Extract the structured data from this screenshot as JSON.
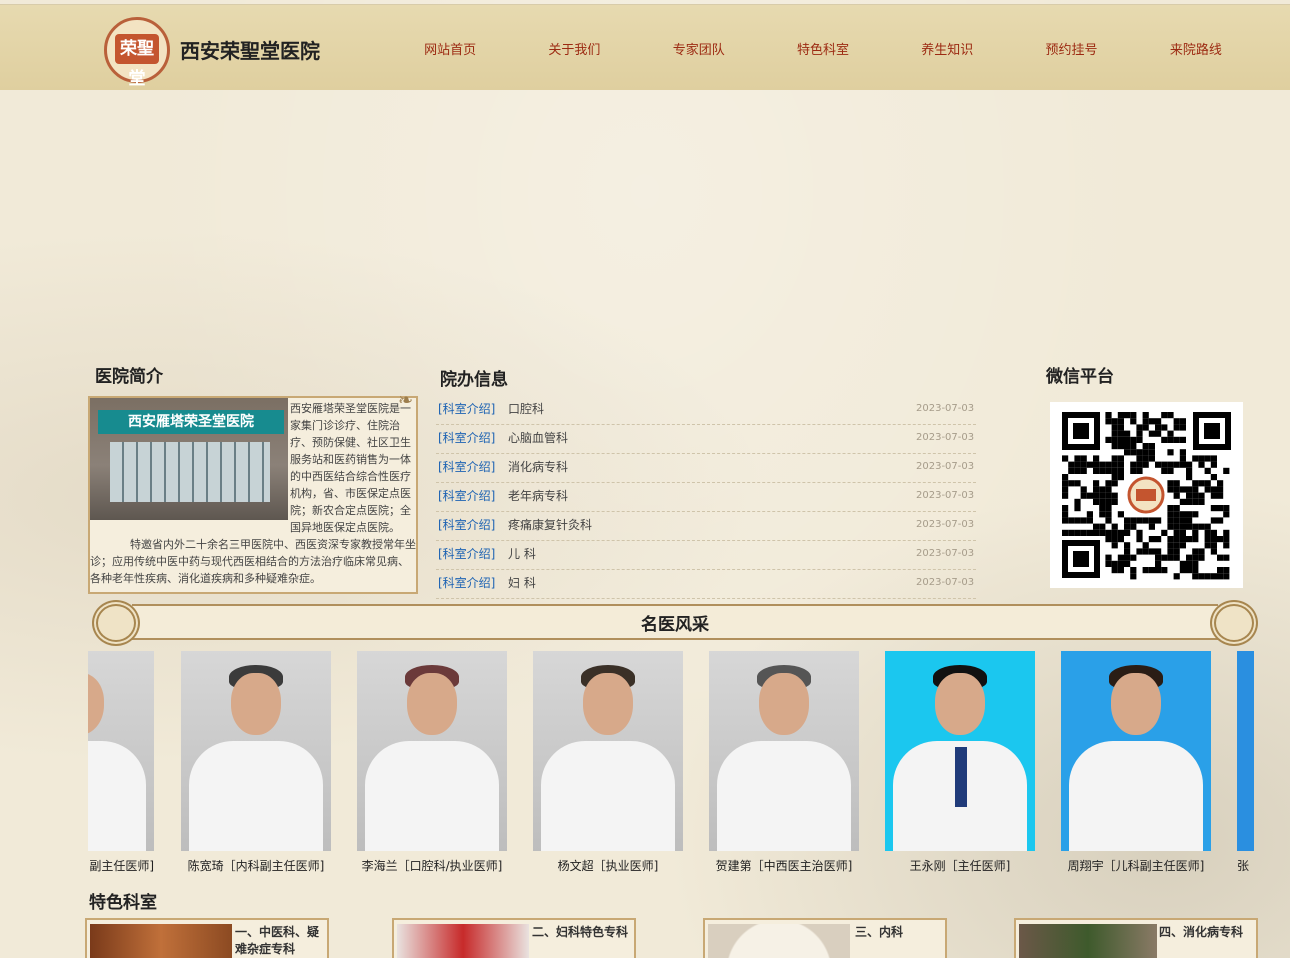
{
  "site": {
    "logo_text": "荣聖堂",
    "title": "西安荣聖堂医院"
  },
  "nav": [
    {
      "label": "网站首页"
    },
    {
      "label": "关于我们"
    },
    {
      "label": "专家团队"
    },
    {
      "label": "特色科室"
    },
    {
      "label": "养生知识"
    },
    {
      "label": "预约挂号"
    },
    {
      "label": "来院路线"
    }
  ],
  "intro": {
    "title": "医院简介",
    "image_sign": "西安雁塔荣圣堂医院",
    "paragraph1": "西安雁塔荣圣堂医院是一家集门诊诊疗、住院治疗、预防保健、社区卫生服务站和医药销售为一体的中西医结合综合性医疗机构，省、市医保定点医院；新农合定点医院；全国异地医保定点医院。",
    "paragraph2": "特邀省内外二十余名三甲医院中、西医资深专家教授常年坐诊；应用传统中医中药与现代西医相结合的方法治疗临床常见病、各种老年性疾病、消化道疾病和多种疑难杂症。"
  },
  "news": {
    "title": "院办信息",
    "items": [
      {
        "tag": "[科室介绍]",
        "title": "口腔科",
        "date": "2023-07-03"
      },
      {
        "tag": "[科室介绍]",
        "title": "心脑血管科",
        "date": "2023-07-03"
      },
      {
        "tag": "[科室介绍]",
        "title": "消化病专科",
        "date": "2023-07-03"
      },
      {
        "tag": "[科室介绍]",
        "title": "老年病专科",
        "date": "2023-07-03"
      },
      {
        "tag": "[科室介绍]",
        "title": "疼痛康复针灸科",
        "date": "2023-07-03"
      },
      {
        "tag": "[科室介绍]",
        "title": "儿 科",
        "date": "2023-07-03"
      },
      {
        "tag": "[科室介绍]",
        "title": "妇 科",
        "date": "2023-07-03"
      }
    ]
  },
  "wechat": {
    "title": "微信平台"
  },
  "doctors_section": {
    "title": "名医风采"
  },
  "doctors": [
    {
      "name": "副主任医师]"
    },
    {
      "name": "陈宽琦［内科副主任医师]"
    },
    {
      "name": "李海兰［口腔科/执业医师]"
    },
    {
      "name": "杨文超［执业医师]"
    },
    {
      "name": "贺建第［中西医主治医师]"
    },
    {
      "name": "王永刚［主任医师]"
    },
    {
      "name": "周翔宇［儿科副主任医师]"
    },
    {
      "name": "张"
    }
  ],
  "depts_section": {
    "title": "特色科室"
  },
  "depts": [
    {
      "label": "一、中医科、疑难杂症专科"
    },
    {
      "label": "二、妇科特色专科"
    },
    {
      "label": "三、内科"
    },
    {
      "label": "四、消化病专科"
    }
  ],
  "colors": {
    "nav_text": "#9c2a12",
    "news_tag": "#1d63b3",
    "border": "#c8a874"
  }
}
